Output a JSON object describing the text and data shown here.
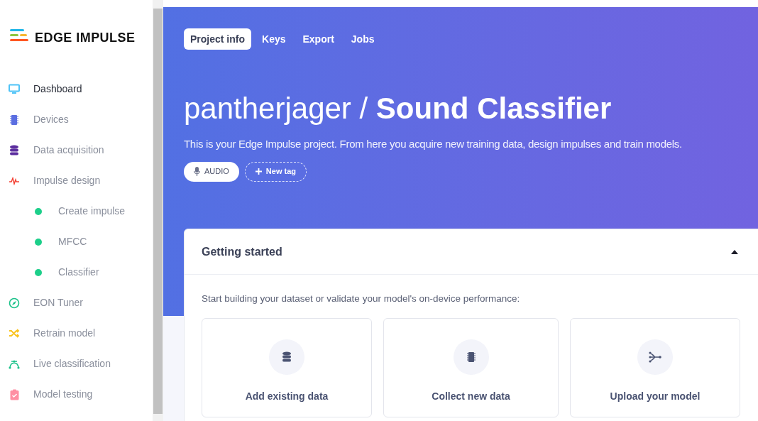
{
  "logo": {
    "text": "EDGE IMPULSE"
  },
  "sidebar": {
    "items": [
      {
        "label": "Dashboard",
        "selected": true
      },
      {
        "label": "Devices",
        "selected": false
      },
      {
        "label": "Data acquisition",
        "selected": false
      },
      {
        "label": "Impulse design",
        "selected": false,
        "children": [
          {
            "label": "Create impulse",
            "selected": false
          },
          {
            "label": "MFCC",
            "selected": false
          },
          {
            "label": "Classifier",
            "selected": false
          }
        ]
      },
      {
        "label": "EON Tuner",
        "selected": false
      },
      {
        "label": "Retrain model",
        "selected": false
      },
      {
        "label": "Live classification",
        "selected": false
      },
      {
        "label": "Model testing",
        "selected": false
      }
    ]
  },
  "tabs": [
    {
      "label": "Project info",
      "selected": true
    },
    {
      "label": "Keys",
      "selected": false
    },
    {
      "label": "Export",
      "selected": false
    },
    {
      "label": "Jobs",
      "selected": false
    }
  ],
  "project": {
    "owner": "pantherjager / ",
    "name": "Sound Classifier",
    "description": "This is your Edge Impulse project. From here you acquire new training data, design impulses and train models."
  },
  "tags": [
    {
      "kind": "tag",
      "label": "AUDIO"
    },
    {
      "kind": "add",
      "label": "New tag"
    }
  ],
  "getting_started": {
    "title": "Getting started",
    "expanded": true,
    "intro": "Start building your dataset or validate your model's on-device performance:",
    "tiles": [
      {
        "label": "Add existing data"
      },
      {
        "label": "Collect new data"
      },
      {
        "label": "Upload your model"
      }
    ]
  }
}
